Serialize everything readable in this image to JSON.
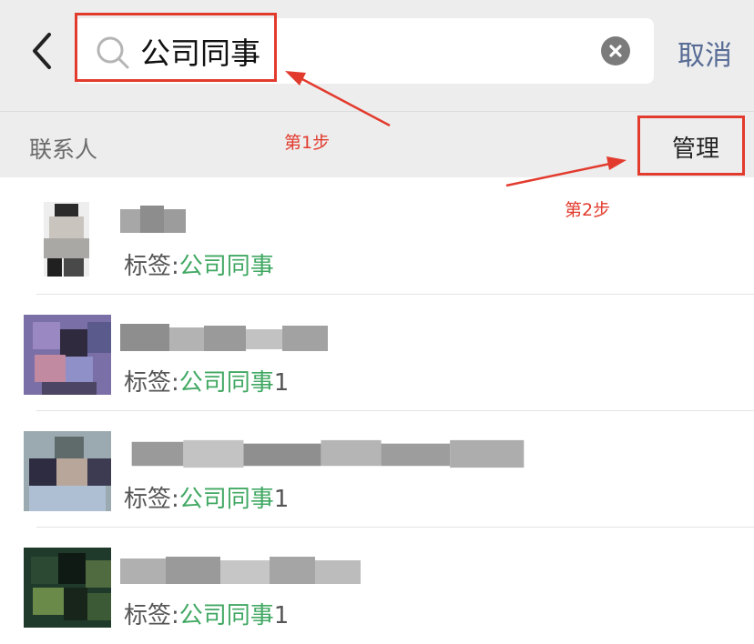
{
  "search": {
    "query": "公司同事",
    "cancel_label": "取消"
  },
  "section": {
    "title": "联系人",
    "manage_label": "管理"
  },
  "annotations": {
    "step1": "第1步",
    "step2": "第2步",
    "color": "#e23b2e"
  },
  "contacts": [
    {
      "tag_prefix": "标签:",
      "tag_value": "公司同事",
      "tag_suffix": ""
    },
    {
      "tag_prefix": "标签:",
      "tag_value": "公司同事",
      "tag_suffix": "1"
    },
    {
      "tag_prefix": "标签:",
      "tag_value": "公司同事",
      "tag_suffix": "1"
    },
    {
      "tag_prefix": "标签:",
      "tag_value": "公司同事",
      "tag_suffix": "1"
    }
  ],
  "colors": {
    "header_bg": "#ededed",
    "tag_green": "#41a863",
    "cancel_blue": "#576b95"
  },
  "icons": [
    "back-arrow-icon",
    "search-icon",
    "clear-icon"
  ]
}
